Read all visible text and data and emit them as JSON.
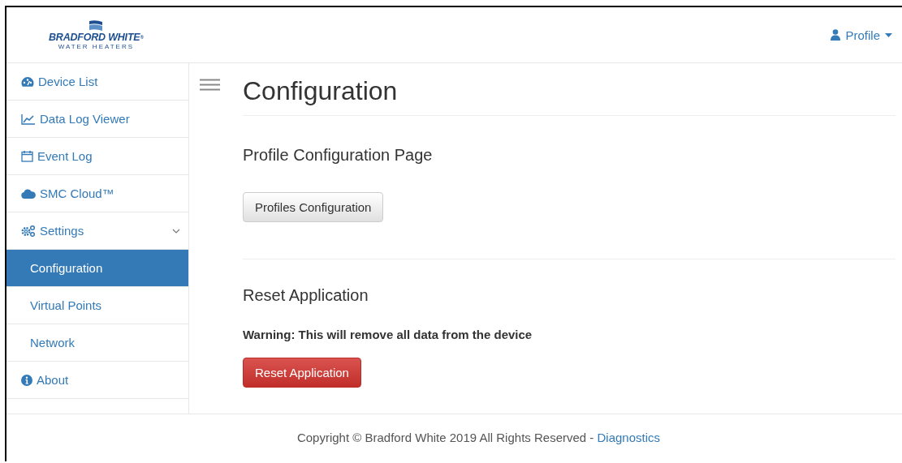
{
  "logo": {
    "name": "BRADFORD WHITE",
    "mark": "®",
    "tagline": "WATER HEATERS"
  },
  "profile_menu": {
    "label": "Profile"
  },
  "sidebar": {
    "items": [
      {
        "label": "Device List",
        "selected": false
      },
      {
        "label": "Data Log Viewer",
        "selected": false
      },
      {
        "label": "Event Log",
        "selected": false
      },
      {
        "label": "SMC Cloud™",
        "selected": false
      },
      {
        "label": "Settings",
        "selected": false,
        "expanded": true,
        "children": [
          {
            "label": "Configuration",
            "selected": true
          },
          {
            "label": "Virtual Points",
            "selected": false
          },
          {
            "label": "Network",
            "selected": false
          }
        ]
      },
      {
        "label": "About",
        "selected": false
      }
    ]
  },
  "page": {
    "title": "Configuration",
    "sections": [
      {
        "title": "Profile Configuration Page",
        "button": {
          "label": "Profiles Configuration",
          "kind": "default"
        }
      },
      {
        "title": "Reset Application",
        "warning": "Warning: This will remove all data from the device",
        "button": {
          "label": "Reset Application",
          "kind": "danger"
        }
      }
    ]
  },
  "footer": {
    "text": "Copyright © Bradford White 2019 All Rights Reserved -",
    "link": "Diagnostics"
  }
}
